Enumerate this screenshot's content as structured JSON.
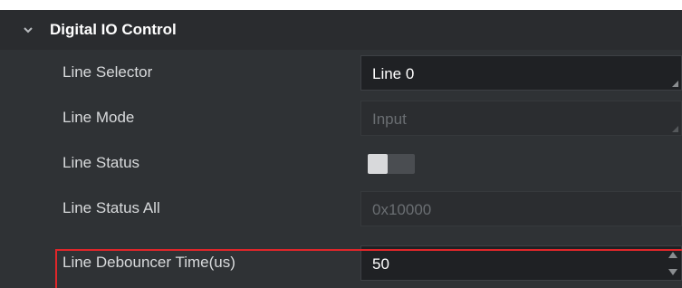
{
  "section": {
    "title": "Digital IO Control",
    "expanded_icon": "chevron-down-icon"
  },
  "rows": [
    {
      "label": "Line Selector",
      "value": "Line 0",
      "control": "select",
      "enabled": true
    },
    {
      "label": "Line Mode",
      "value": "Input",
      "control": "select",
      "enabled": false
    },
    {
      "label": "Line Status",
      "value": "",
      "control": "toggle",
      "state": "off",
      "enabled": false
    },
    {
      "label": "Line Status All",
      "value": "0x10000",
      "control": "readonly",
      "enabled": false
    },
    {
      "label": "Line Debouncer Time(us)",
      "value": "50",
      "control": "spinbox",
      "enabled": true,
      "highlighted": true
    }
  ],
  "colors": {
    "highlight": "#e0262a",
    "panel_bg": "#2f3235",
    "header_bg": "#2a2c2f"
  }
}
